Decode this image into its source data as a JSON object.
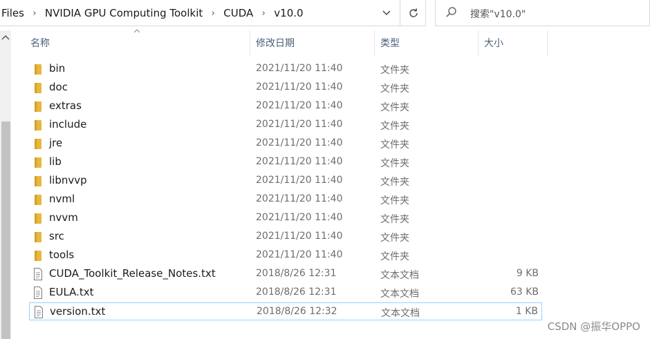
{
  "breadcrumb": [
    "Files",
    "NVIDIA GPU Computing Toolkit",
    "CUDA",
    "v10.0"
  ],
  "search": {
    "placeholder": "搜索\"v10.0\""
  },
  "columns": {
    "name": "名称",
    "date": "修改日期",
    "type": "类型",
    "size": "大小"
  },
  "files": [
    {
      "name": "bin",
      "date": "2021/11/20 11:40",
      "type": "文件夹",
      "size": "",
      "kind": "folder"
    },
    {
      "name": "doc",
      "date": "2021/11/20 11:40",
      "type": "文件夹",
      "size": "",
      "kind": "folder"
    },
    {
      "name": "extras",
      "date": "2021/11/20 11:40",
      "type": "文件夹",
      "size": "",
      "kind": "folder"
    },
    {
      "name": "include",
      "date": "2021/11/20 11:40",
      "type": "文件夹",
      "size": "",
      "kind": "folder"
    },
    {
      "name": "jre",
      "date": "2021/11/20 11:40",
      "type": "文件夹",
      "size": "",
      "kind": "folder"
    },
    {
      "name": "lib",
      "date": "2021/11/20 11:40",
      "type": "文件夹",
      "size": "",
      "kind": "folder"
    },
    {
      "name": "libnvvp",
      "date": "2021/11/20 11:40",
      "type": "文件夹",
      "size": "",
      "kind": "folder"
    },
    {
      "name": "nvml",
      "date": "2021/11/20 11:40",
      "type": "文件夹",
      "size": "",
      "kind": "folder"
    },
    {
      "name": "nvvm",
      "date": "2021/11/20 11:40",
      "type": "文件夹",
      "size": "",
      "kind": "folder"
    },
    {
      "name": "src",
      "date": "2021/11/20 11:40",
      "type": "文件夹",
      "size": "",
      "kind": "folder"
    },
    {
      "name": "tools",
      "date": "2021/11/20 11:40",
      "type": "文件夹",
      "size": "",
      "kind": "folder"
    },
    {
      "name": "CUDA_Toolkit_Release_Notes.txt",
      "date": "2018/8/26 12:31",
      "type": "文本文档",
      "size": "9 KB",
      "kind": "text"
    },
    {
      "name": "EULA.txt",
      "date": "2018/8/26 12:31",
      "type": "文本文档",
      "size": "63 KB",
      "kind": "text"
    },
    {
      "name": "version.txt",
      "date": "2018/8/26 12:32",
      "type": "文本文档",
      "size": "1 KB",
      "kind": "text",
      "selected": true
    }
  ],
  "watermark": "CSDN @振华OPPO",
  "colors": {
    "folder": "#e8b73d",
    "folder_dark": "#d4a02a",
    "selection_border": "#99d1ff",
    "header_text": "#4c607a"
  }
}
